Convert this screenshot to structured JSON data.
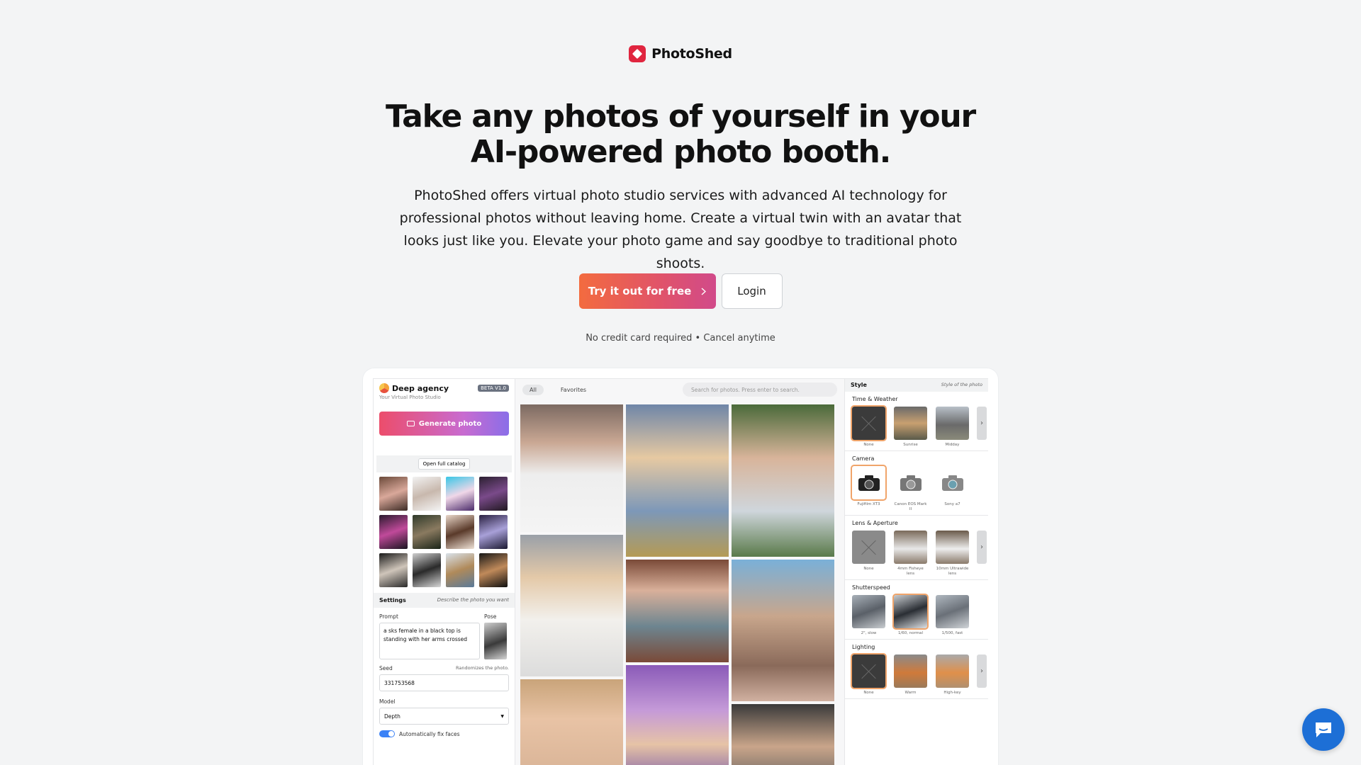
{
  "brand": {
    "name": "PhotoShed"
  },
  "hero": {
    "headline_line1": "Take any photos of yourself in your",
    "headline_line2": "AI-powered photo booth.",
    "subtext": "PhotoShed offers virtual photo studio services with advanced AI technology for professional photos without leaving home. Create a virtual twin with an avatar that looks just like you. Elevate your photo game and say goodbye to traditional photo shoots.",
    "cta_primary": "Try it out for free",
    "cta_secondary": "Login",
    "note": "No credit card required • Cancel anytime"
  },
  "app": {
    "sidebar": {
      "title": "Deep agency",
      "badge": "BETA V1.0",
      "subtitle": "Your Virtual Photo Studio",
      "generate_label": "Generate photo",
      "catalog_label": "Open full catalog",
      "settings_title": "Settings",
      "settings_desc": "Describe the photo you want",
      "prompt_label": "Prompt",
      "pose_label": "Pose",
      "prompt_value": "a sks female in a black top is standing with her arms crossed",
      "seed_label": "Seed",
      "seed_hint": "Randomizes the photo.",
      "seed_value": "331753568",
      "model_label": "Model",
      "model_value": "Depth",
      "fix_faces_label": "Automatically fix faces"
    },
    "gallery": {
      "tab_all": "All",
      "tab_favorites": "Favorites",
      "search_placeholder": "Search for photos. Press enter to search."
    },
    "style_panel": {
      "title": "Style",
      "desc": "Style of the photo",
      "sections": [
        {
          "title": "Time & Weather",
          "options": [
            "None",
            "Sunrise",
            "Midday"
          ]
        },
        {
          "title": "Camera",
          "options": [
            "Fujifilm XT3",
            "Canon EOS Mark II",
            "Sony a7"
          ]
        },
        {
          "title": "Lens & Aperture",
          "options": [
            "None",
            "4mm Fisheye lens",
            "10mm Ultrawide lens"
          ]
        },
        {
          "title": "Shutterspeed",
          "options": [
            "2\", slow",
            "1/60, normal",
            "1/500, fast"
          ]
        },
        {
          "title": "Lighting",
          "options": [
            "None",
            "Warm",
            "High-key"
          ]
        }
      ]
    }
  },
  "colors": {
    "brand": "#e0253f",
    "cta_gradient_start": "#f36b3f",
    "cta_gradient_end": "#d14a8a",
    "chat": "#1d6fd6"
  }
}
